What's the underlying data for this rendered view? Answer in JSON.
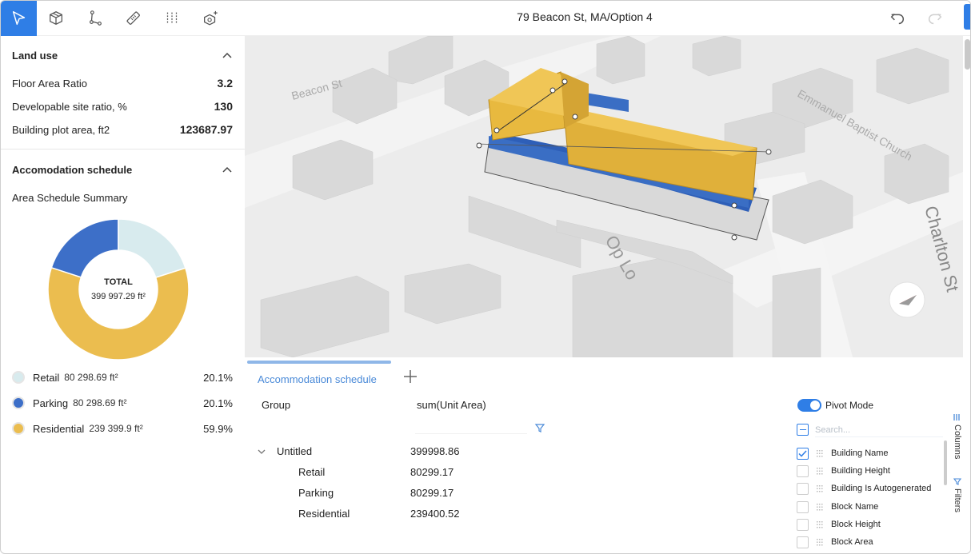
{
  "toolbar": {
    "tools": [
      "select-tool",
      "box-tool",
      "polyline-tool",
      "measure-tool",
      "split-tool",
      "add-object-tool"
    ],
    "title": "79 Beacon St, MA/Option 4"
  },
  "land_use": {
    "header": "Land use",
    "rows": [
      {
        "label": "Floor Area Ratio",
        "value": "3.2"
      },
      {
        "label": "Developable site ratio, %",
        "value": "130"
      },
      {
        "label": "Building plot area, ft2",
        "value": "123687.97"
      }
    ]
  },
  "accommodation": {
    "header": "Accomodation schedule",
    "subtitle": "Area Schedule Summary",
    "total_label": "TOTAL",
    "total_value": "399 997.29 ft²",
    "legend": [
      {
        "name": "Retail",
        "value": "80 298.69 ft²",
        "pct": "20.1%",
        "color": "#d8ebee",
        "fraction": 0.201
      },
      {
        "name": "Parking",
        "value": "80 298.69 ft²",
        "pct": "20.1%",
        "color": "#3d6fc8",
        "fraction": 0.201
      },
      {
        "name": "Residential",
        "value": "239 399.9 ft²",
        "pct": "59.9%",
        "color": "#ebbd4f",
        "fraction": 0.599
      }
    ]
  },
  "map": {
    "street_labels": [
      "Beacon St",
      "Charlton St",
      "Emmanuel Baptist Church",
      "Op Lo"
    ],
    "colors": {
      "building": "#e8b93f",
      "base": "#3a6ec4",
      "ground": "#ececec"
    }
  },
  "bottom": {
    "tab_label": "Accommodation schedule",
    "group_header": "Group",
    "value_header": "sum(Unit Area)",
    "tree": {
      "label": "Untitled",
      "value": "399998.86",
      "children": [
        {
          "label": "Retail",
          "value": "80299.17"
        },
        {
          "label": "Parking",
          "value": "80299.17"
        },
        {
          "label": "Residential",
          "value": "239400.52"
        }
      ]
    },
    "side_panel": {
      "pivot_label": "Pivot Mode",
      "search_placeholder": "Search...",
      "columns": [
        {
          "name": "Building Name",
          "checked": true
        },
        {
          "name": "Building Height",
          "checked": false
        },
        {
          "name": "Building Is Autogenerated",
          "checked": false
        },
        {
          "name": "Block Name",
          "checked": false
        },
        {
          "name": "Block Height",
          "checked": false
        },
        {
          "name": "Block Area",
          "checked": false
        }
      ],
      "tab_columns": "Columns",
      "tab_filters": "Filters"
    }
  }
}
